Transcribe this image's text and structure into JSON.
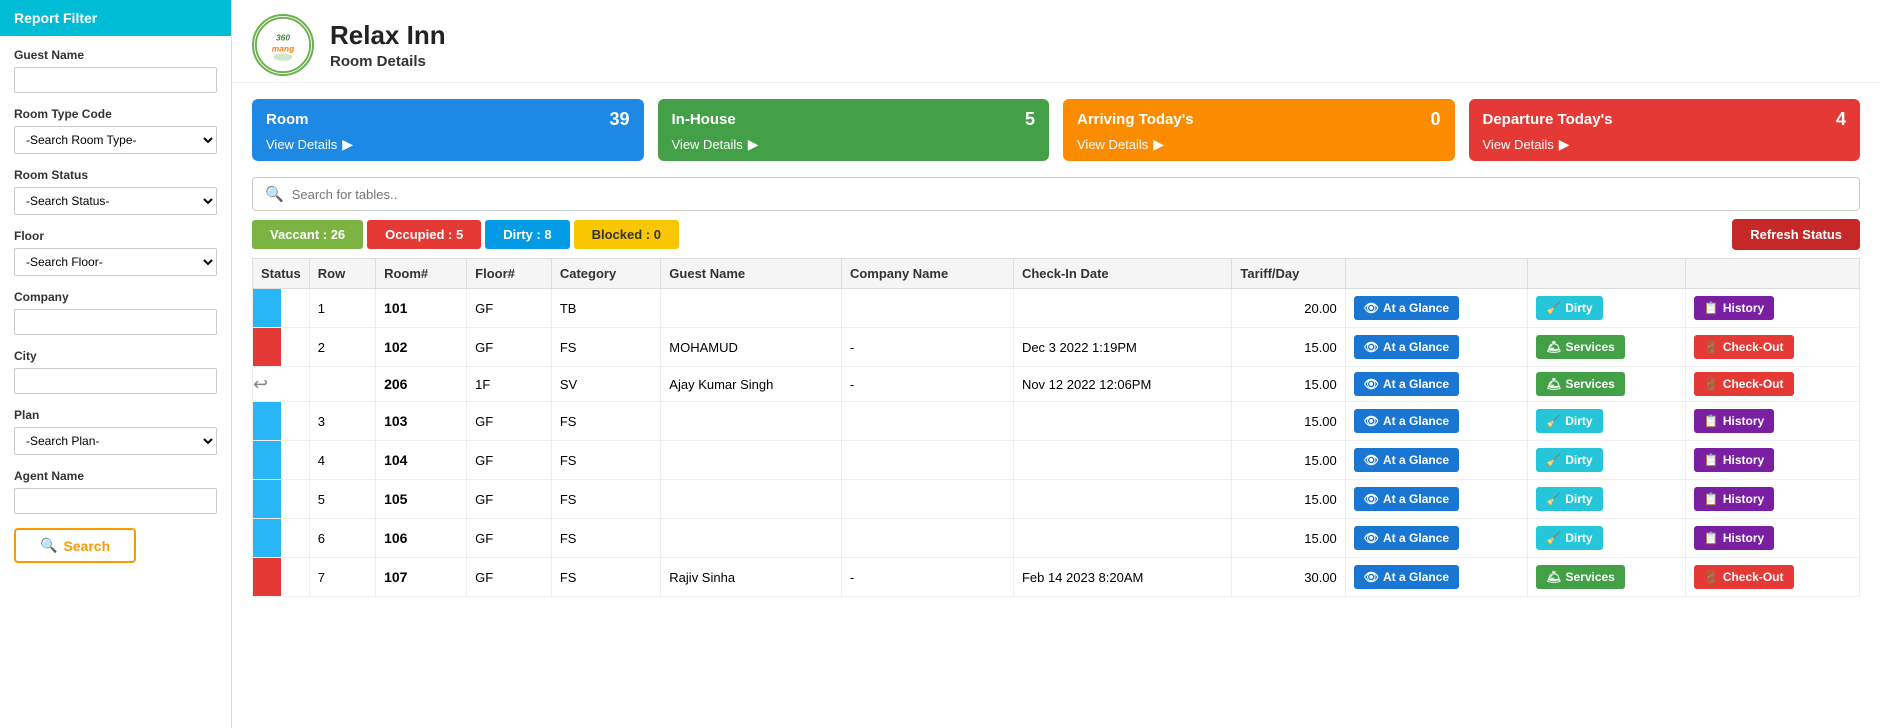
{
  "sidebar": {
    "header": "Report Filter",
    "filters": [
      {
        "id": "guest-name",
        "label": "Guest Name",
        "type": "text",
        "placeholder": "",
        "value": ""
      },
      {
        "id": "room-type",
        "label": "Room Type Code",
        "type": "select",
        "placeholder": "-Search Room Type-",
        "options": [
          "-Search Room Type-"
        ]
      },
      {
        "id": "room-status",
        "label": "Room Status",
        "type": "select",
        "placeholder": "-Search Status-",
        "options": [
          "-Search Status-"
        ]
      },
      {
        "id": "floor",
        "label": "Floor",
        "type": "select",
        "placeholder": "-Search Floor-",
        "options": [
          "-Search Floor-"
        ]
      },
      {
        "id": "company",
        "label": "Company",
        "type": "text",
        "placeholder": "",
        "value": ""
      },
      {
        "id": "city",
        "label": "City",
        "type": "text",
        "placeholder": "",
        "value": ""
      },
      {
        "id": "plan",
        "label": "Plan",
        "type": "select",
        "placeholder": "-Search Plan-",
        "options": [
          "-Search Plan-"
        ]
      },
      {
        "id": "agent-name",
        "label": "Agent Name",
        "type": "text",
        "placeholder": "",
        "value": ""
      }
    ],
    "search_button": "Search"
  },
  "header": {
    "hotel_name": "Relax Inn",
    "page_subtitle": "Room Details",
    "logo_text": "360mang"
  },
  "stats": [
    {
      "id": "room",
      "title": "Room",
      "number": "39",
      "link_text": "View Details",
      "color": "card-blue"
    },
    {
      "id": "in-house",
      "title": "In-House",
      "number": "5",
      "link_text": "View Details",
      "color": "card-green"
    },
    {
      "id": "arriving",
      "title": "Arriving Today's",
      "number": "0",
      "link_text": "View Details",
      "color": "card-orange"
    },
    {
      "id": "departure",
      "title": "Departure Today's",
      "number": "4",
      "link_text": "View Details",
      "color": "card-red"
    }
  ],
  "search": {
    "placeholder": "Search for tables.."
  },
  "badges": [
    {
      "label": "Vaccant : 26",
      "color": "badge-green"
    },
    {
      "label": "Occupied : 5",
      "color": "badge-red"
    },
    {
      "label": "Dirty : 8",
      "color": "badge-blue"
    },
    {
      "label": "Blocked : 0",
      "color": "badge-yellow"
    }
  ],
  "refresh_button": "Refresh Status",
  "table": {
    "columns": [
      "Status",
      "Row",
      "Room#",
      "Floor#",
      "Category",
      "Guest Name",
      "Company Name",
      "Check-In Date",
      "Tariff/Day",
      "",
      "",
      ""
    ],
    "rows": [
      {
        "status": "blue",
        "row": "1",
        "room": "101",
        "floor": "GF",
        "category": "TB",
        "guest": "",
        "company": "",
        "checkin": "",
        "tariff": "20.00",
        "actions": [
          "glance",
          "dirty",
          "history"
        ]
      },
      {
        "status": "red",
        "row": "2",
        "room": "102",
        "floor": "GF",
        "category": "FS",
        "guest": "MOHAMUD",
        "company": "-",
        "checkin": "Dec 3 2022 1:19PM",
        "tariff": "15.00",
        "actions": [
          "glance",
          "services",
          "checkout"
        ]
      },
      {
        "status": "redirect",
        "row": "",
        "room": "206",
        "floor": "1F",
        "category": "SV",
        "guest": "Ajay Kumar Singh",
        "company": "-",
        "checkin": "Nov 12 2022 12:06PM",
        "tariff": "15.00",
        "actions": [
          "glance",
          "services",
          "checkout"
        ]
      },
      {
        "status": "blue",
        "row": "3",
        "room": "103",
        "floor": "GF",
        "category": "FS",
        "guest": "",
        "company": "",
        "checkin": "",
        "tariff": "15.00",
        "actions": [
          "glance",
          "dirty",
          "history"
        ]
      },
      {
        "status": "blue",
        "row": "4",
        "room": "104",
        "floor": "GF",
        "category": "FS",
        "guest": "",
        "company": "",
        "checkin": "",
        "tariff": "15.00",
        "actions": [
          "glance",
          "dirty",
          "history"
        ]
      },
      {
        "status": "blue",
        "row": "5",
        "room": "105",
        "floor": "GF",
        "category": "FS",
        "guest": "",
        "company": "",
        "checkin": "",
        "tariff": "15.00",
        "actions": [
          "glance",
          "dirty",
          "history"
        ]
      },
      {
        "status": "blue",
        "row": "6",
        "room": "106",
        "floor": "GF",
        "category": "FS",
        "guest": "",
        "company": "",
        "checkin": "",
        "tariff": "15.00",
        "actions": [
          "glance",
          "dirty",
          "history"
        ]
      },
      {
        "status": "red",
        "row": "7",
        "room": "107",
        "floor": "GF",
        "category": "FS",
        "guest": "Rajiv Sinha",
        "company": "-",
        "checkin": "Feb 14 2023 8:20AM",
        "tariff": "30.00",
        "actions": [
          "glance",
          "services",
          "checkout"
        ]
      }
    ]
  },
  "buttons": {
    "at_a_glance": "At a Glance",
    "dirty": "Dirty",
    "history": "History",
    "services": "Services",
    "check_out": "Check-Out"
  }
}
